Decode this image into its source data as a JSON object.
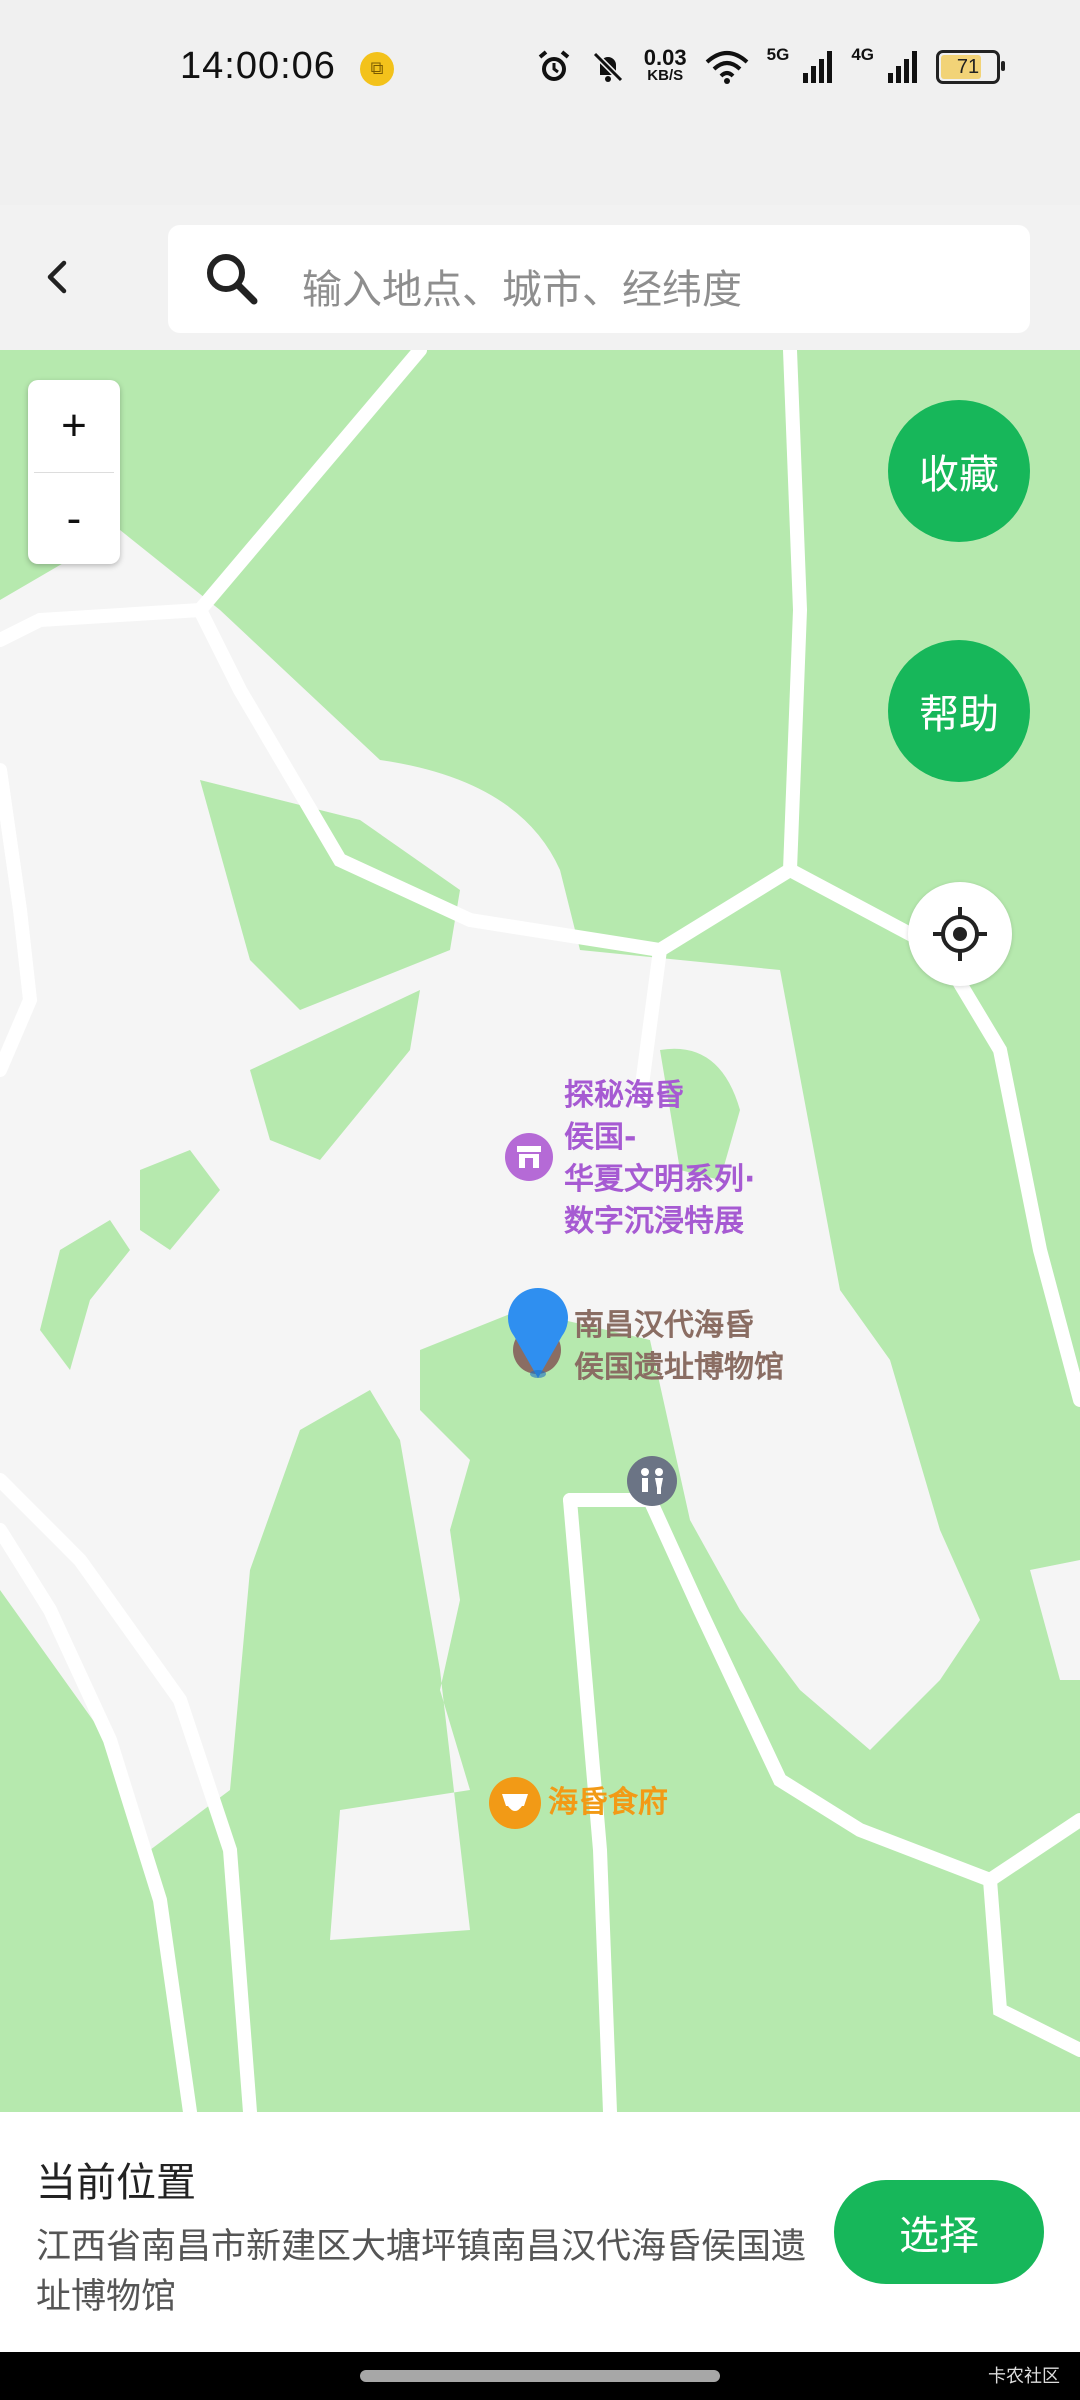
{
  "status_bar": {
    "time": "14:00:06",
    "net_speed_value": "0.03",
    "net_speed_unit": "KB/S",
    "net1": "5G",
    "net2": "4G",
    "battery": "71",
    "battery_level_percent": 71
  },
  "search": {
    "placeholder": "输入地点、城市、经纬度"
  },
  "map": {
    "zoom_in_label": "+",
    "zoom_out_label": "-",
    "favorite_label": "收藏",
    "help_label": "帮助",
    "pois": {
      "exhibition": "探秘海昏\n侯国-\n华夏文明系列·\n数字沉浸特展",
      "museum": "南昌汉代海昏\n侯国遗址博物馆",
      "restaurant": "海昏食府"
    },
    "colors": {
      "green_area": "#b6e9ae",
      "plaza": "#f5f5f5",
      "accent": "#17b75a",
      "pin": "#2f8ff0",
      "exhibition_text": "#a65ad2",
      "museum_text": "#8a6d63",
      "restaurant_text": "#f29a16"
    }
  },
  "bottom_panel": {
    "title": "当前位置",
    "address": "江西省南昌市新建区大塘坪镇南昌汉代海昏侯国遗址博物馆",
    "select_label": "选择"
  },
  "watermark": "卡农社区"
}
